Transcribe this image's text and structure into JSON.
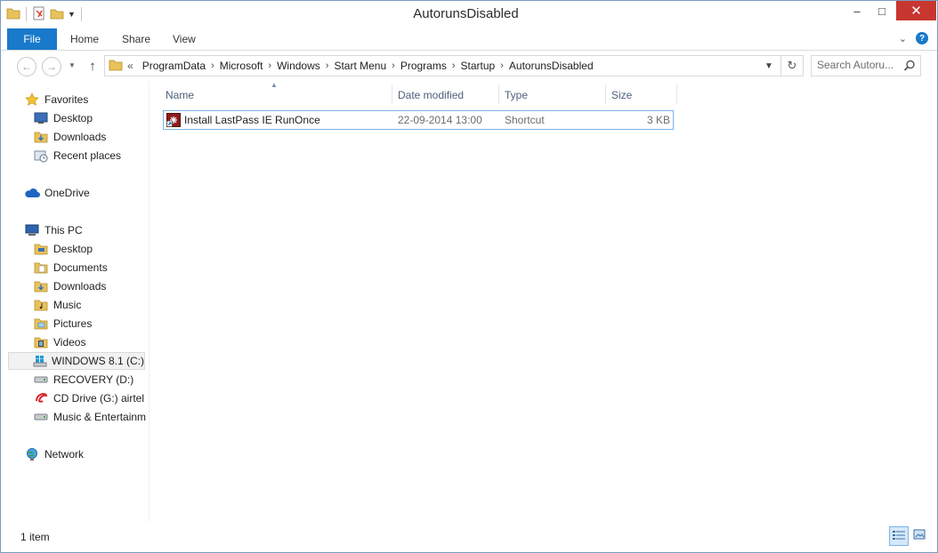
{
  "window": {
    "title": "AutorunsDisabled",
    "minimize": "–",
    "maximize": "□",
    "close": "✕"
  },
  "ribbon": {
    "file": "File",
    "tabs": [
      "Home",
      "Share",
      "View"
    ]
  },
  "address": {
    "overflow": "«",
    "crumbs": [
      "ProgramData",
      "Microsoft",
      "Windows",
      "Start Menu",
      "Programs",
      "Startup",
      "AutorunsDisabled"
    ]
  },
  "search": {
    "placeholder": "Search Autoru..."
  },
  "nav": {
    "favorites": {
      "label": "Favorites",
      "items": [
        "Desktop",
        "Downloads",
        "Recent places"
      ]
    },
    "onedrive": "OneDrive",
    "thispc": {
      "label": "This PC",
      "items": [
        "Desktop",
        "Documents",
        "Downloads",
        "Music",
        "Pictures",
        "Videos",
        "WINDOWS 8.1 (C:)",
        "RECOVERY (D:)",
        "CD Drive (G:) airtel",
        "Music & Entertainm"
      ]
    },
    "network": "Network"
  },
  "columns": {
    "name": "Name",
    "date": "Date modified",
    "type": "Type",
    "size": "Size"
  },
  "files": [
    {
      "name": "Install LastPass IE RunOnce",
      "date": "22-09-2014 13:00",
      "type": "Shortcut",
      "size": "3 KB"
    }
  ],
  "status": {
    "count": "1 item"
  },
  "colors": {
    "accent": "#1979ca",
    "close": "#c7372f",
    "selection": "#7eb4ea"
  }
}
